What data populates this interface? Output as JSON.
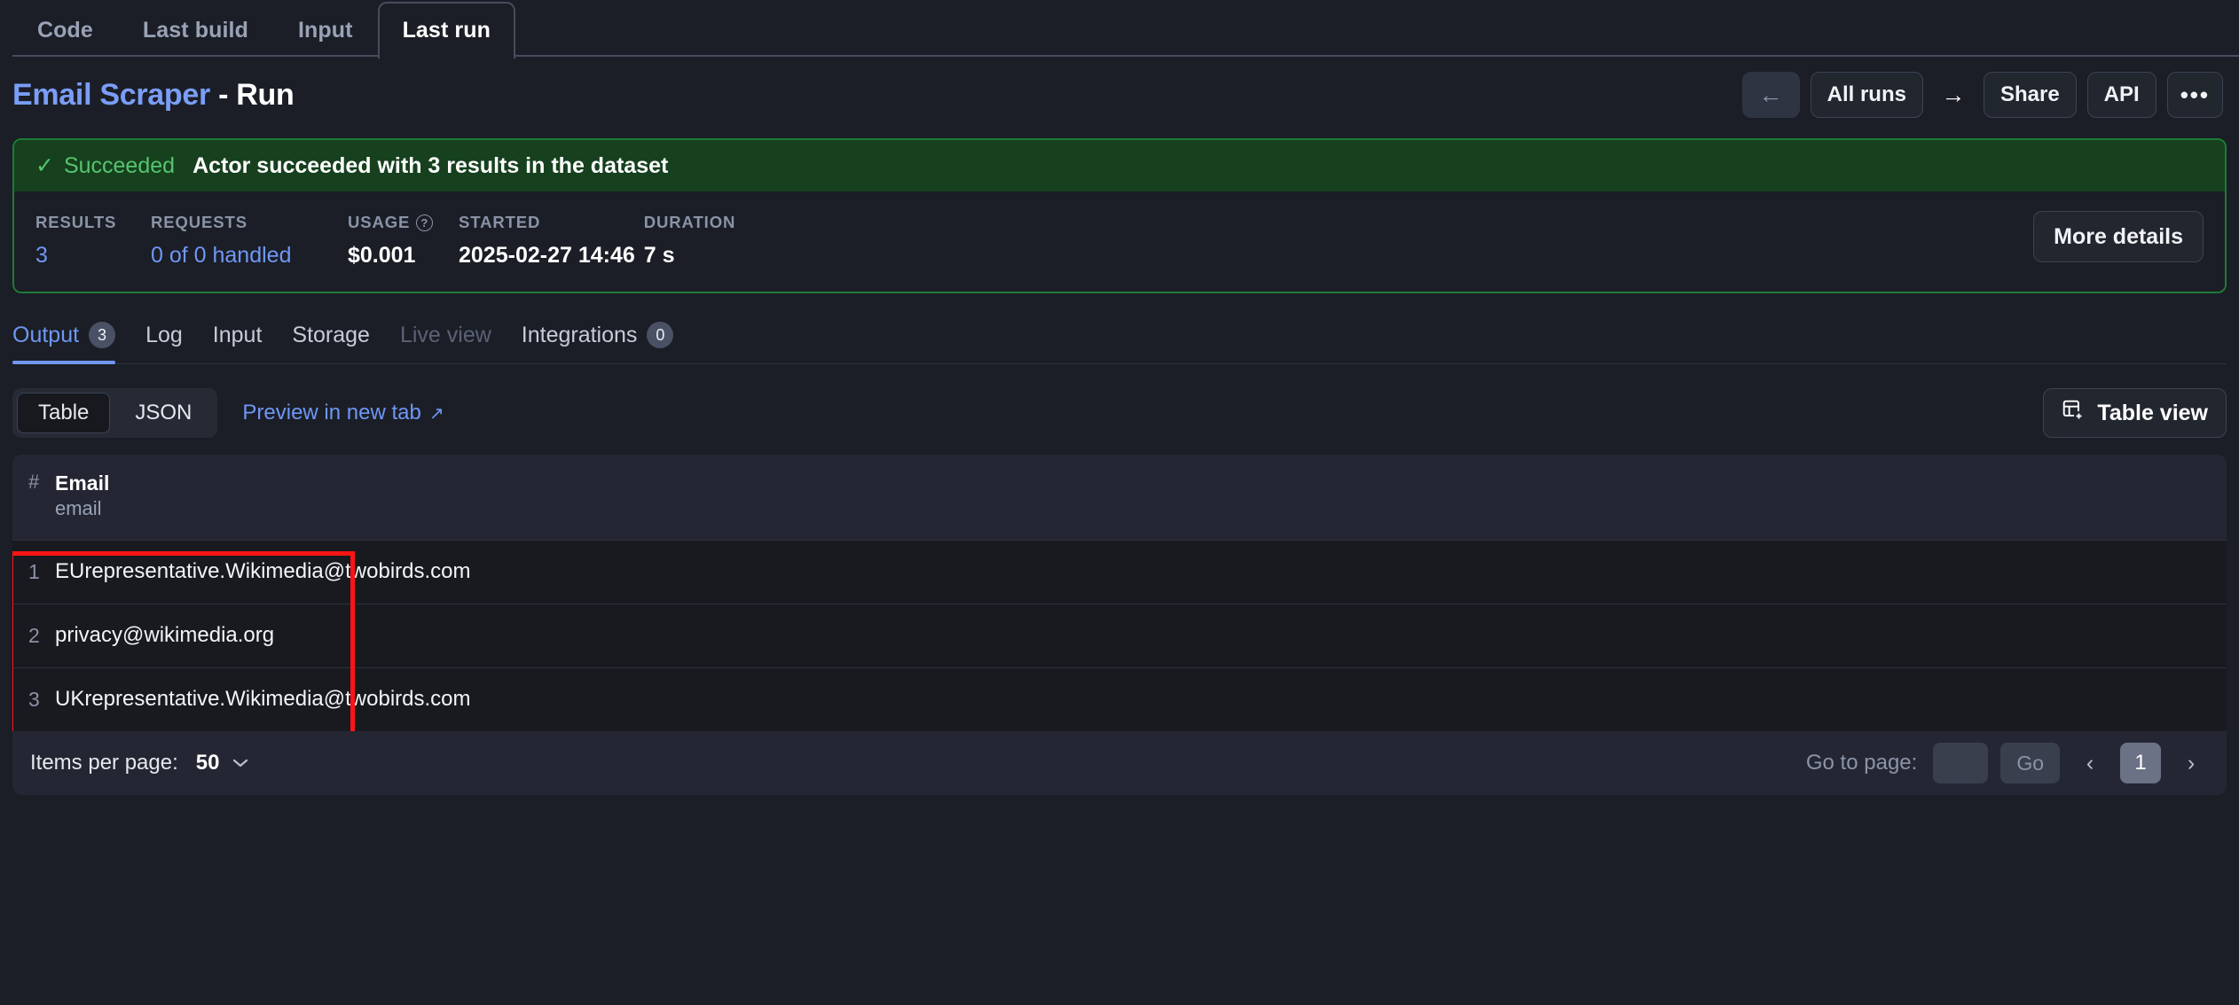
{
  "top_tabs": [
    {
      "label": "Code",
      "active": false
    },
    {
      "label": "Last build",
      "active": false
    },
    {
      "label": "Input",
      "active": false
    },
    {
      "label": "Last run",
      "active": true
    }
  ],
  "header": {
    "actor_name": "Email Scraper",
    "suffix": "- Run",
    "back_icon": "arrow-left-icon",
    "all_runs_label": "All runs",
    "forward_icon": "arrow-right-icon",
    "share_label": "Share",
    "api_label": "API",
    "more_label": "•••"
  },
  "run_status": {
    "check_icon": "✓",
    "status_label": "Succeeded",
    "message": "Actor succeeded with 3 results in the dataset",
    "accent_color": "#1f7a37",
    "banner_bg": "#16401e",
    "status_color": "#56c46f",
    "more_details_label": "More details",
    "stats": [
      {
        "label": "RESULTS",
        "value": "3",
        "style": "bluenum",
        "help": false
      },
      {
        "label": "REQUESTS",
        "value": "0 of 0 handled",
        "style": "link",
        "help": false
      },
      {
        "label": "USAGE",
        "value": "$0.001",
        "style": "plain",
        "help": true
      },
      {
        "label": "STARTED",
        "value": "2025-02-27 14:46",
        "style": "plain",
        "help": false
      },
      {
        "label": "DURATION",
        "value": "7 s",
        "style": "plain",
        "help": false
      }
    ]
  },
  "section_tabs": [
    {
      "label": "Output",
      "badge": "3",
      "active": true,
      "disabled": false
    },
    {
      "label": "Log",
      "badge": "",
      "active": false,
      "disabled": false
    },
    {
      "label": "Input",
      "badge": "",
      "active": false,
      "disabled": false
    },
    {
      "label": "Storage",
      "badge": "",
      "active": false,
      "disabled": false
    },
    {
      "label": "Live view",
      "badge": "",
      "active": false,
      "disabled": true
    },
    {
      "label": "Integrations",
      "badge": "0",
      "active": false,
      "disabled": false
    }
  ],
  "view_controls": {
    "segments": [
      {
        "label": "Table",
        "active": true
      },
      {
        "label": "JSON",
        "active": false
      }
    ],
    "preview_label": "Preview in new tab",
    "preview_icon": "↗",
    "table_view_label": "Table view",
    "table_view_icon": "table-add-icon"
  },
  "table": {
    "index_header": "#",
    "column_title": "Email",
    "column_key": "email",
    "rows": [
      {
        "index": "1",
        "email": "EUrepresentative.Wikimedia@twobirds.com"
      },
      {
        "index": "2",
        "email": "privacy@wikimedia.org"
      },
      {
        "index": "3",
        "email": "UKrepresentative.Wikimedia@twobirds.com"
      }
    ],
    "annotation_color": "#ff1414"
  },
  "pagination": {
    "items_per_page_label": "Items per page:",
    "items_per_page_value": "50",
    "chevron_icon": "⌄",
    "go_to_page_label": "Go to page:",
    "go_to_page_value": "",
    "go_to_page_placeholder": "",
    "go_label": "Go",
    "prev_icon": "‹",
    "current_page": "1",
    "next_icon": "›"
  }
}
